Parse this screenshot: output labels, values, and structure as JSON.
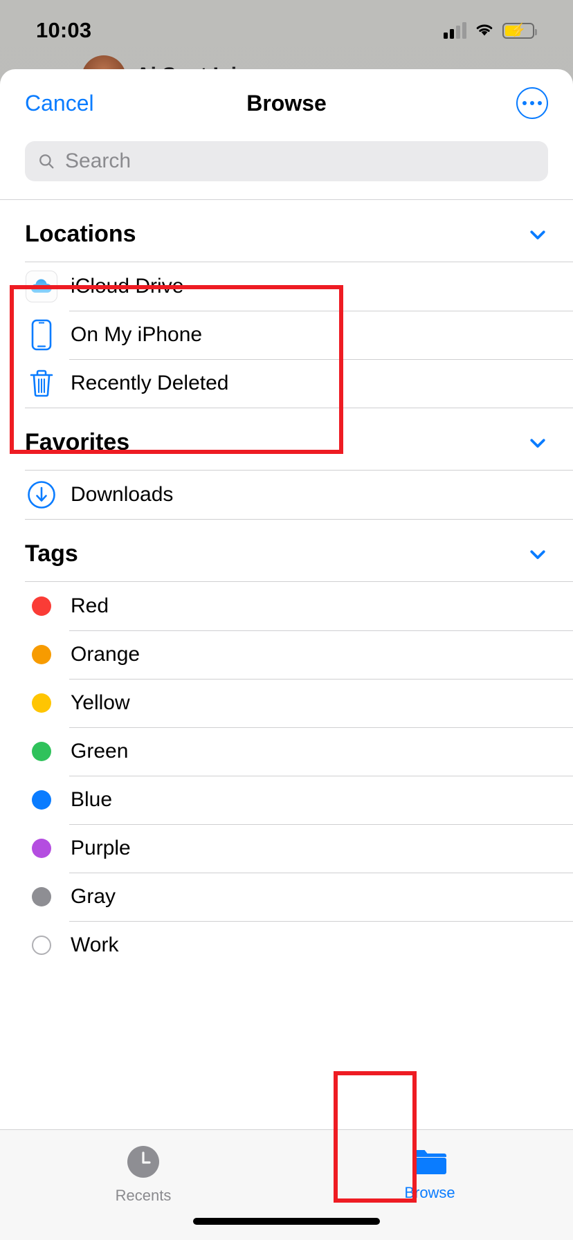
{
  "status_bar": {
    "time": "10:03",
    "cellular_icon": "signal-bars-icon",
    "wifi_icon": "wifi-icon",
    "battery_icon": "battery-charging-icon"
  },
  "background_app": {
    "contact_name": "Ai Sept   L i",
    "avatar": "contact-avatar"
  },
  "nav_bar": {
    "cancel_label": "Cancel",
    "title": "Browse",
    "more_icon": "more-ellipsis-icon"
  },
  "search": {
    "placeholder": "Search",
    "value": "",
    "icon": "search-icon"
  },
  "sections": [
    {
      "title": "Locations",
      "collapse_icon": "chevron-down-icon",
      "items": [
        {
          "label": "iCloud Drive",
          "icon": "icloud-drive-icon"
        },
        {
          "label": "On My iPhone",
          "icon": "iphone-icon"
        },
        {
          "label": "Recently Deleted",
          "icon": "trash-icon"
        }
      ]
    },
    {
      "title": "Favorites",
      "collapse_icon": "chevron-down-icon",
      "items": [
        {
          "label": "Downloads",
          "icon": "downloads-circle-arrow-icon"
        }
      ]
    },
    {
      "title": "Tags",
      "collapse_icon": "chevron-down-icon",
      "items": [
        {
          "label": "Red",
          "icon": "tag-dot-icon",
          "color": "#fa3c36"
        },
        {
          "label": "Orange",
          "icon": "tag-dot-icon",
          "color": "#f79b00"
        },
        {
          "label": "Yellow",
          "icon": "tag-dot-icon",
          "color": "#ffc502"
        },
        {
          "label": "Green",
          "icon": "tag-dot-icon",
          "color": "#2fc25b"
        },
        {
          "label": "Blue",
          "icon": "tag-dot-icon",
          "color": "#0a7cff"
        },
        {
          "label": "Purple",
          "icon": "tag-dot-icon",
          "color": "#b44de0"
        },
        {
          "label": "Gray",
          "icon": "tag-dot-icon",
          "color": "#8e8e93"
        },
        {
          "label": "Work",
          "icon": "tag-dot-outline-icon",
          "color": ""
        }
      ]
    }
  ],
  "tab_bar": {
    "tabs": [
      {
        "label": "Recents",
        "icon": "clock-icon",
        "active": false
      },
      {
        "label": "Browse",
        "icon": "folder-icon",
        "active": true
      }
    ]
  },
  "annotations": {
    "locations_highlight": "red-annotation-box",
    "browse_tab_highlight": "red-annotation-box"
  },
  "colors": {
    "accent": "#0a7cff",
    "annotation": "#ee1c23",
    "separator": "#cfcfd1",
    "search_field": "#eaeaec"
  }
}
